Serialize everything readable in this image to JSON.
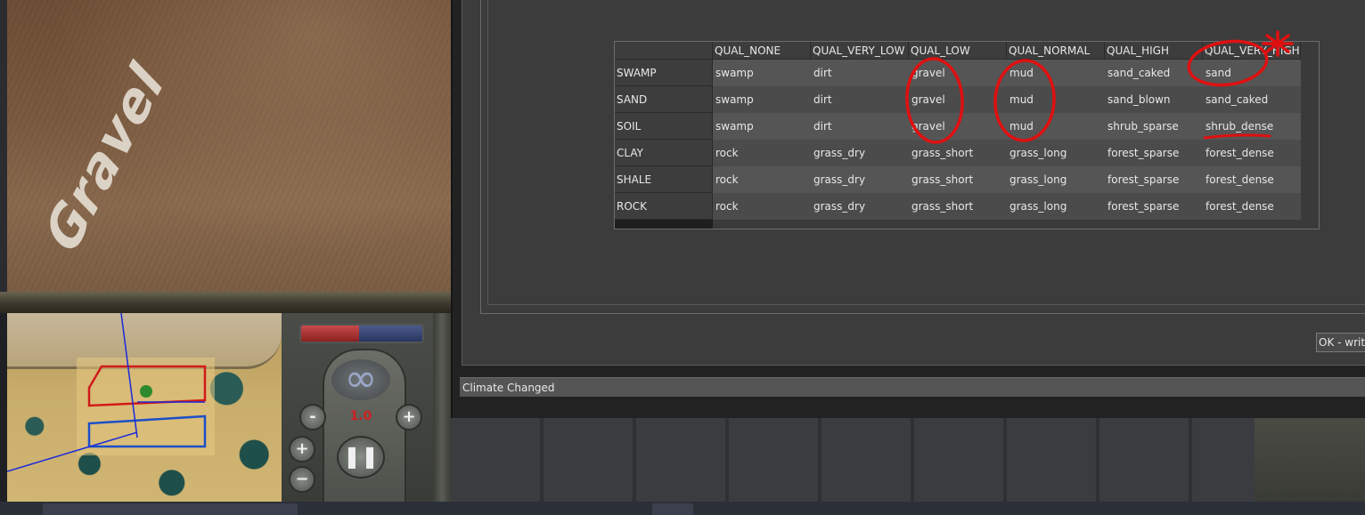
{
  "game": {
    "ground_label": "Gravel",
    "speed": "1.0",
    "plus_label": "+",
    "minus_label": "-",
    "zoom_in_label": "+",
    "zoom_out_label": "−",
    "pause_label": "❚❚",
    "infinity_label": "∞"
  },
  "editor": {
    "ok_label": "OK - write",
    "status": "Climate Changed",
    "table": {
      "columns": [
        "QUAL_NONE",
        "QUAL_VERY_LOW",
        "QUAL_LOW",
        "QUAL_NORMAL",
        "QUAL_HIGH",
        "QUAL_VERY_HIGH"
      ],
      "rows": [
        {
          "label": "SWAMP",
          "cells": [
            "swamp",
            "dirt",
            "gravel",
            "mud",
            "sand_caked",
            "sand"
          ]
        },
        {
          "label": "SAND",
          "cells": [
            "swamp",
            "dirt",
            "gravel",
            "mud",
            "sand_blown",
            "sand_caked"
          ]
        },
        {
          "label": "SOIL",
          "cells": [
            "swamp",
            "dirt",
            "gravel",
            "mud",
            "shrub_sparse",
            "shrub_dense"
          ]
        },
        {
          "label": "CLAY",
          "cells": [
            "rock",
            "grass_dry",
            "grass_short",
            "grass_long",
            "forest_sparse",
            "forest_dense"
          ]
        },
        {
          "label": "SHALE",
          "cells": [
            "rock",
            "grass_dry",
            "grass_short",
            "grass_long",
            "forest_sparse",
            "forest_dense"
          ]
        },
        {
          "label": "ROCK",
          "cells": [
            "rock",
            "grass_dry",
            "grass_short",
            "grass_long",
            "forest_sparse",
            "forest_dense"
          ]
        }
      ]
    }
  },
  "colors": {
    "annotation": "#e01010",
    "row_odd": "#555555",
    "row_even": "#4b4b4b"
  }
}
